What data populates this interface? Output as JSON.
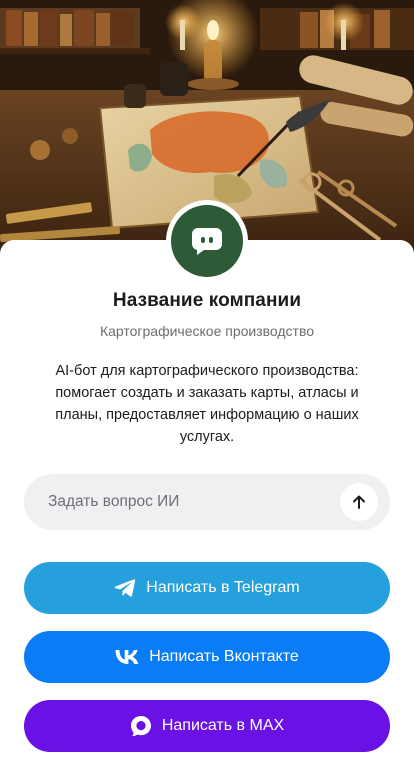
{
  "colors": {
    "avatar_bg": "#2d5a37",
    "telegram": "#26a0dc",
    "vk": "#0a7df6",
    "max": "#6a11e6"
  },
  "hero": {
    "icon": "cartography-workshop-illustration"
  },
  "company": {
    "avatar_icon": "chat-bubble-icon",
    "name": "Название компании",
    "subtitle": "Картографическое производство",
    "description": "AI-бот для картографического производства: помогает создать и заказать карты, атласы и планы, предоставляет информацию о наших услугах."
  },
  "ask": {
    "placeholder": "Задать вопрос ИИ",
    "value": "",
    "send_icon": "arrow-up-icon"
  },
  "buttons": {
    "telegram": {
      "label": "Написать в Telegram",
      "icon": "telegram-icon"
    },
    "vk": {
      "label": "Написать Вконтакте",
      "icon": "vk-icon"
    },
    "max": {
      "label": "Написать в MAX",
      "icon": "max-icon"
    }
  }
}
